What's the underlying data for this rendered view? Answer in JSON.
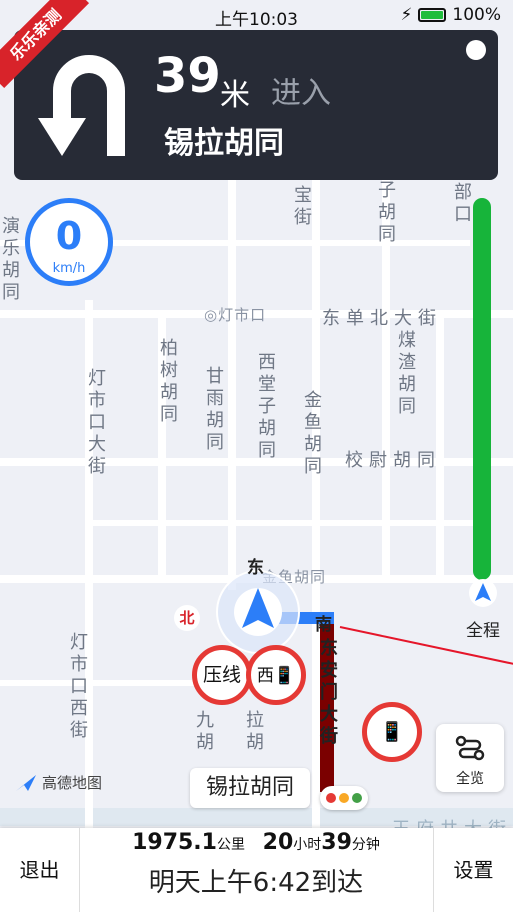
{
  "status": {
    "time": "上午10:03",
    "battery": "100%"
  },
  "ribbon": "乐乐亲测",
  "guidance": {
    "distance": "39",
    "unit": "米",
    "action": "进入",
    "road": "锡拉胡同"
  },
  "speed": {
    "value": "0",
    "unit": "km/h"
  },
  "progress": {
    "label": "全程"
  },
  "map": {
    "poi": "灯市口",
    "poi2": "金鱼胡同",
    "streets_h": [
      "东单北大街",
      "校尉胡同",
      "王府井大街"
    ],
    "streets_v": [
      "宝街",
      "子胡同",
      "部口",
      "演乐胡同",
      "柏树胡同",
      "甘雨胡同",
      "西堂子胡同",
      "金鱼胡同",
      "煤渣胡同",
      "灯市口大街",
      "灯市口西街",
      "东安门大街",
      "拉胡",
      "九胡"
    ],
    "compass": {
      "n": "北",
      "e": "东",
      "s": "南"
    }
  },
  "signs": {
    "no_lane_change": "压线",
    "west": "西"
  },
  "current_road": "锡拉胡同",
  "overview": {
    "label": "全览"
  },
  "logo": "高德地图",
  "bottom": {
    "exit": "退出",
    "distance_value": "1975.1",
    "distance_unit": "公里",
    "hours": "20",
    "hours_unit": "小时",
    "minutes": "39",
    "minutes_unit": "分钟",
    "arrival": "明天上午6:42到达",
    "settings": "设置"
  },
  "colors": {
    "accent": "#2c7ef8",
    "progress": "#17b43a",
    "banner": "#272b36",
    "alert": "#e53935"
  }
}
